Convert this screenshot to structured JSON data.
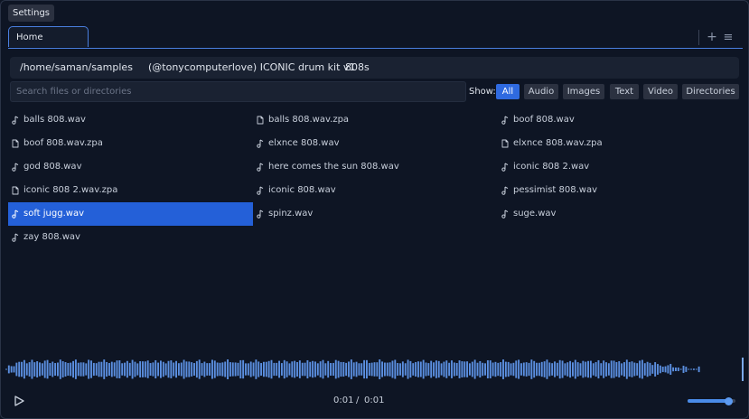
{
  "settings_label": "Settings",
  "tabs": [
    {
      "label": "Home",
      "active": true
    }
  ],
  "tab_controls": {
    "add": "+",
    "menu": "≡"
  },
  "breadcrumbs": [
    "/home/saman/samples",
    "(@tonycomputerlove) ICONIC drum kit v1",
    "808s"
  ],
  "search": {
    "placeholder": "Search files or directories",
    "value": ""
  },
  "filters": {
    "label": "Show:",
    "options": [
      "All",
      "Audio",
      "Images",
      "Text",
      "Video",
      "Directories"
    ],
    "active": "All"
  },
  "files": [
    {
      "name": "balls 808.wav",
      "type": "audio"
    },
    {
      "name": "balls 808.wav.zpa",
      "type": "file"
    },
    {
      "name": "boof 808.wav",
      "type": "audio"
    },
    {
      "name": "boof 808.wav.zpa",
      "type": "file"
    },
    {
      "name": "elxnce 808.wav",
      "type": "audio"
    },
    {
      "name": "elxnce 808.wav.zpa",
      "type": "file"
    },
    {
      "name": "god 808.wav",
      "type": "audio"
    },
    {
      "name": "here comes the sun 808.wav",
      "type": "audio"
    },
    {
      "name": "iconic 808 2.wav",
      "type": "audio"
    },
    {
      "name": "iconic 808 2.wav.zpa",
      "type": "file"
    },
    {
      "name": "iconic 808.wav",
      "type": "audio"
    },
    {
      "name": "pessimist 808.wav",
      "type": "audio"
    },
    {
      "name": "soft jugg.wav",
      "type": "audio",
      "selected": true
    },
    {
      "name": "spinz.wav",
      "type": "audio"
    },
    {
      "name": "suge.wav",
      "type": "audio"
    },
    {
      "name": "zay 808.wav",
      "type": "audio"
    }
  ],
  "player": {
    "current_time": "0:01",
    "separator": "/",
    "duration": "0:01",
    "volume": 0.85,
    "waveform_color": "#5b8fe0"
  },
  "colors": {
    "accent": "#2f6ae0",
    "selected_row": "#2460d8",
    "background": "#0e1524"
  }
}
